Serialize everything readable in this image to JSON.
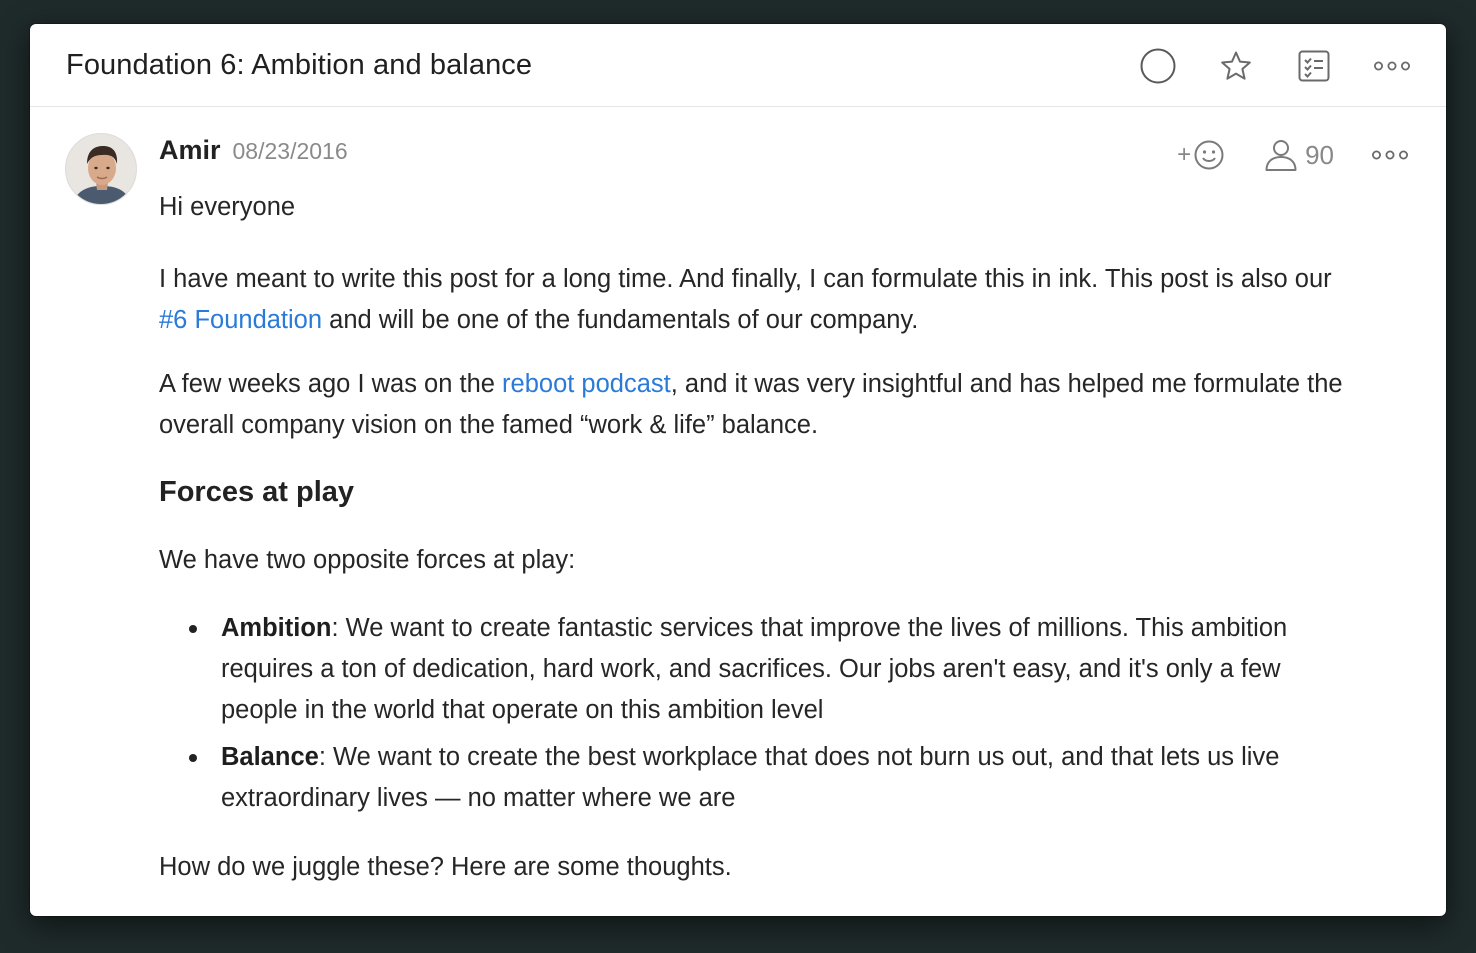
{
  "header": {
    "title": "Foundation 6: Ambition and balance",
    "actions": [
      {
        "name": "mark-done",
        "icon": "circle-icon"
      },
      {
        "name": "favorite",
        "icon": "star-icon"
      },
      {
        "name": "add-task",
        "icon": "checklist-icon"
      },
      {
        "name": "more",
        "icon": "ellipsis-icon"
      }
    ]
  },
  "post": {
    "author": "Amir",
    "date": "08/23/2016",
    "reaction_plus": "+",
    "participants_count": "90",
    "greeting": "Hi everyone",
    "para1_a": "I have meant to write this post for a long time. And finally, I can formulate this in ink. This post is also our ",
    "para1_link": "#6 Foundation",
    "para1_b": " and will be one of the fundamentals of our company.",
    "para2_a": "A few weeks ago I was on the ",
    "para2_link": "reboot podcast",
    "para2_b": ", and it was very insightful and has helped me formulate the overall company vision on the famed “work & life” balance.",
    "heading": "Forces at play",
    "para3": "We have two opposite forces at play:",
    "bullets": [
      {
        "term": "Ambition",
        "text": ": We want to create fantastic services that improve the lives of millions. This ambition requires a ton of dedication, hard work, and sacrifices. Our jobs aren't easy, and it's only a few people in the world that operate on this ambition level"
      },
      {
        "term": "Balance",
        "text": ": We want to create the best workplace that does not burn us out, and that lets us live extraordinary lives — no matter where we are"
      }
    ],
    "para4": "How do we juggle these? Here are some thoughts."
  },
  "colors": {
    "link": "#2a7ad8",
    "icon_gray": "#888888",
    "text": "#262626"
  }
}
